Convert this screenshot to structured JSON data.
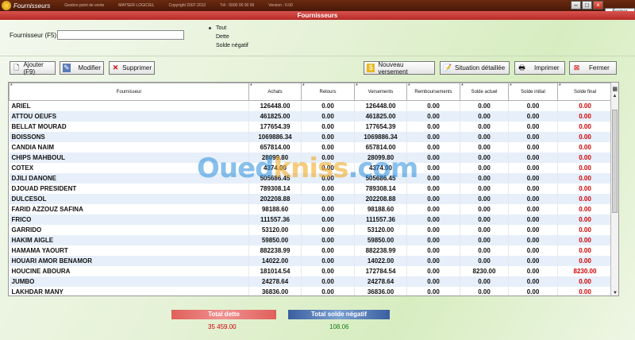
{
  "window": {
    "title": "Fournisseurs",
    "meta": [
      "Gestion point de vente",
      "MAYSER LOGICIEL",
      "Copyright 2007-2013",
      "Tél : 0000 00 00 00",
      "Version : 0.00"
    ],
    "tab_close": "Fermer"
  },
  "header": {
    "title": "Fournisseurs"
  },
  "filter": {
    "label": "Fournisseur (F5)",
    "value": "",
    "radios": [
      {
        "label": "Tout",
        "selected": true
      },
      {
        "label": "Dette",
        "selected": false
      },
      {
        "label": "Solde négatif",
        "selected": false
      }
    ]
  },
  "toolbar": {
    "add": "Ajouter (F9)",
    "edit": "Modifier",
    "delete": "Supprimer",
    "new_payment": "Nouveau versement",
    "detailed": "Situation détaillée",
    "print": "Imprimer",
    "close": "Fermer"
  },
  "table": {
    "columns": [
      "Fournisseur",
      "Achats",
      "Retours",
      "Versements",
      "Remboursements",
      "Solde actuel",
      "Solde initial",
      "Solde final"
    ],
    "rows": [
      [
        "ARIEL",
        "126448.00",
        "0.00",
        "126448.00",
        "0.00",
        "0.00",
        "0.00",
        "0.00"
      ],
      [
        "ATTOU OEUFS",
        "461825.00",
        "0.00",
        "461825.00",
        "0.00",
        "0.00",
        "0.00",
        "0.00"
      ],
      [
        "BELLAT MOURAD",
        "177654.39",
        "0.00",
        "177654.39",
        "0.00",
        "0.00",
        "0.00",
        "0.00"
      ],
      [
        "BOISSONS",
        "1069886.34",
        "0.00",
        "1069886.34",
        "0.00",
        "0.00",
        "0.00",
        "0.00"
      ],
      [
        "CANDIA NAIM",
        "657814.00",
        "0.00",
        "657814.00",
        "0.00",
        "0.00",
        "0.00",
        "0.00"
      ],
      [
        "CHIPS MAHBOUL",
        "28099.80",
        "0.00",
        "28099.80",
        "0.00",
        "0.00",
        "0.00",
        "0.00"
      ],
      [
        "COTEX",
        "4374.00",
        "0.00",
        "4374.00",
        "0.00",
        "0.00",
        "0.00",
        "0.00"
      ],
      [
        "DJILI DANONE",
        "505686.45",
        "0.00",
        "505686.45",
        "0.00",
        "0.00",
        "0.00",
        "0.00"
      ],
      [
        "DJOUAD PRESIDENT",
        "789308.14",
        "0.00",
        "789308.14",
        "0.00",
        "0.00",
        "0.00",
        "0.00"
      ],
      [
        "DULCESOL",
        "202208.88",
        "0.00",
        "202208.88",
        "0.00",
        "0.00",
        "0.00",
        "0.00"
      ],
      [
        "FARID AZZOUZ SAFINA",
        "98188.60",
        "0.00",
        "98188.60",
        "0.00",
        "0.00",
        "0.00",
        "0.00"
      ],
      [
        "FRICO",
        "111557.36",
        "0.00",
        "111557.36",
        "0.00",
        "0.00",
        "0.00",
        "0.00"
      ],
      [
        "GARRIDO",
        "53120.00",
        "0.00",
        "53120.00",
        "0.00",
        "0.00",
        "0.00",
        "0.00"
      ],
      [
        "HAKIM AIGLE",
        "59850.00",
        "0.00",
        "59850.00",
        "0.00",
        "0.00",
        "0.00",
        "0.00"
      ],
      [
        "HAMAMA YAOURT",
        "882238.99",
        "0.00",
        "882238.99",
        "0.00",
        "0.00",
        "0.00",
        "0.00"
      ],
      [
        "HOUARI AMOR BENAMOR",
        "14022.00",
        "0.00",
        "14022.00",
        "0.00",
        "0.00",
        "0.00",
        "0.00"
      ],
      [
        "HOUCINE ABOURA",
        "181014.54",
        "0.00",
        "172784.54",
        "0.00",
        "8230.00",
        "0.00",
        "8230.00"
      ],
      [
        "JUMBO",
        "24278.64",
        "0.00",
        "24278.64",
        "0.00",
        "0.00",
        "0.00",
        "0.00"
      ],
      [
        "LAKHDAR MANY",
        "36836.00",
        "0.00",
        "36836.00",
        "0.00",
        "0.00",
        "0.00",
        "0.00"
      ]
    ]
  },
  "totals": {
    "dette_label": "Total dette",
    "dette_value": "35 459.00",
    "neg_label": "Total solde négatif",
    "neg_value": "108.06"
  },
  "watermark": {
    "part1": "Oued",
    "part2": "kniss",
    "part3": ".com"
  }
}
